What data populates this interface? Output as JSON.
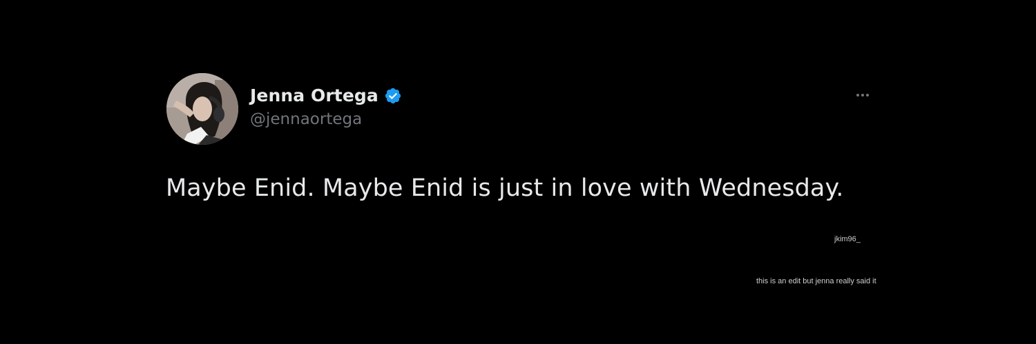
{
  "tweet": {
    "author": {
      "display_name": "Jenna Ortega",
      "handle": "@jennaortega",
      "verified": true,
      "avatar_icon": "profile-photo"
    },
    "text": "Maybe Enid. Maybe Enid is just in love with Wednesday.",
    "more_icon": "more-horizontal-icon"
  },
  "overlay": {
    "watermark": "jkim96_",
    "caption": "this is an edit but jenna really said it"
  },
  "colors": {
    "background": "#000000",
    "primary_text": "#e7e9ea",
    "secondary_text": "#71767b",
    "verified_blue": "#1d9bf0"
  }
}
